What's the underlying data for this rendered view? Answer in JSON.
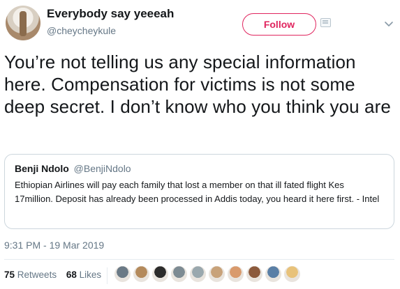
{
  "author": {
    "display_name": "Everybody say yeeeah",
    "handle": "@cheycheykule"
  },
  "header": {
    "follow_label": "Follow"
  },
  "tweet": {
    "text": "You’re not telling us any special information here. Compensation for victims is not some deep secret. I don’t know who you think you are",
    "timestamp": "9:31 PM - 19 Mar 2019"
  },
  "quoted_tweet": {
    "name": "Benji Ndolo",
    "handle": "@BenjiNdolo",
    "text": "Ethiopian Airlines will pay each family that lost a member on that ill fated flight Kes 17million. Deposit has already been processed in Addis today, you heard it here first. - Intel"
  },
  "stats": {
    "retweets_count": "75",
    "retweets_label": "Retweets",
    "likes_count": "68",
    "likes_label": "Likes"
  },
  "likers": {
    "colors": [
      "#6b7a86",
      "#b48a5c",
      "#2c2c2c",
      "#7d8b93",
      "#9aa8ae",
      "#c8a27a",
      "#d99a6c",
      "#8c5a3c",
      "#5a7fa6",
      "#e8c27a"
    ]
  },
  "colors": {
    "follow_accent": "#e0245e",
    "secondary_text": "#657786",
    "border": "#ccd6dd"
  },
  "icons": {
    "card": "card-icon",
    "chevron": "chevron-down-icon"
  }
}
